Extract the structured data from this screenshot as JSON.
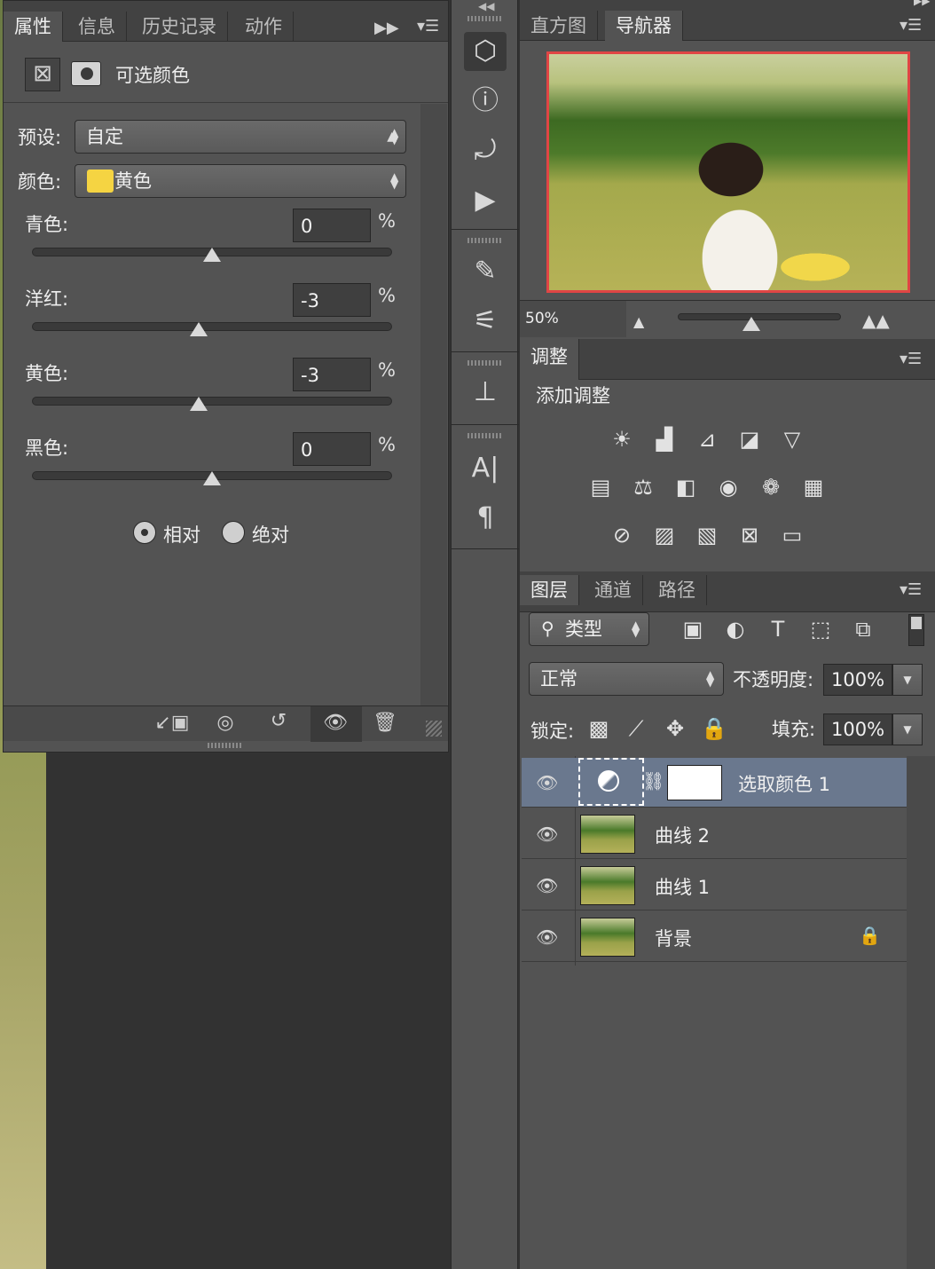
{
  "properties": {
    "tabs": [
      "属性",
      "信息",
      "历史记录",
      "动作"
    ],
    "title": "可选颜色",
    "preset_label": "预设:",
    "preset_value": "自定",
    "color_label": "颜色:",
    "color_value": "黄色",
    "color_swatch": "#f5d442",
    "sliders": [
      {
        "label": "青色:",
        "value": "0",
        "unit": "%",
        "level": 0.0
      },
      {
        "label": "洋红:",
        "value": "-3",
        "unit": "%",
        "level": -0.03
      },
      {
        "label": "黄色:",
        "value": "-3",
        "unit": "%",
        "level": -0.03
      },
      {
        "label": "黑色:",
        "value": "0",
        "unit": "%",
        "level": 0.0
      }
    ],
    "method_relative": "相对",
    "method_absolute": "绝对",
    "method_selected": "相对"
  },
  "navigator": {
    "tabs": [
      "直方图",
      "导航器"
    ],
    "zoom": "50%",
    "zoom_level": 0.45
  },
  "adjustments": {
    "tab": "调整",
    "heading": "添加调整"
  },
  "layers": {
    "tabs": [
      "图层",
      "通道",
      "路径"
    ],
    "filter_kind": "类型",
    "blend_mode": "正常",
    "opacity_label": "不透明度:",
    "opacity_value": "100%",
    "lock_label": "锁定:",
    "fill_label": "填充:",
    "fill_value": "100%",
    "items": [
      {
        "name": "选取颜色 1",
        "selected": true
      },
      {
        "name": "曲线 2",
        "selected": false
      },
      {
        "name": "曲线 1",
        "selected": false
      },
      {
        "name": "背景",
        "selected": false
      }
    ]
  },
  "colors": {
    "panel": "#535353",
    "tabbar": "#424242",
    "selected_layer": "#6a788e",
    "nav_frame": "#e04545"
  }
}
